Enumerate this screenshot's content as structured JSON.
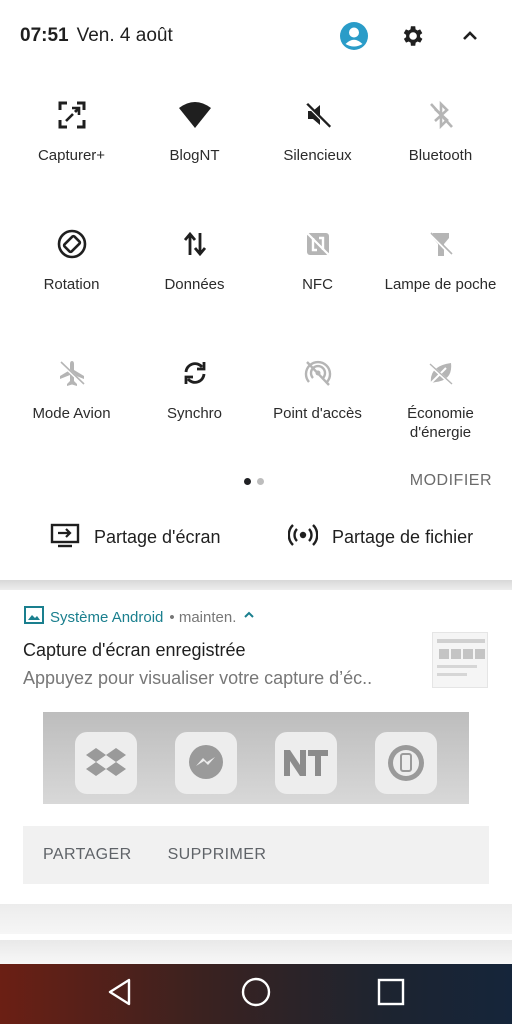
{
  "status_bar": {
    "time": "07:51",
    "date": "Ven. 4 août"
  },
  "tiles": [
    {
      "label": "Capturer+",
      "icon": "screenshot-icon",
      "active": true
    },
    {
      "label": "BlogNT",
      "icon": "wifi-icon",
      "active": true
    },
    {
      "label": "Silencieux",
      "icon": "mute-icon",
      "active": true
    },
    {
      "label": "Bluetooth",
      "icon": "bluetooth-icon",
      "active": false
    },
    {
      "label": "Rotation",
      "icon": "rotation-icon",
      "active": true
    },
    {
      "label": "Données",
      "icon": "data-icon",
      "active": true
    },
    {
      "label": "NFC",
      "icon": "nfc-icon",
      "active": false
    },
    {
      "label": "Lampe de poche",
      "icon": "flashlight-icon",
      "active": false
    },
    {
      "label": "Mode Avion",
      "icon": "airplane-icon",
      "active": false
    },
    {
      "label": "Synchro",
      "icon": "sync-icon",
      "active": true
    },
    {
      "label": "Point d'accès",
      "icon": "hotspot-icon",
      "active": false
    },
    {
      "label": "Économie d'énergie",
      "icon": "battery-saver-icon",
      "active": false
    }
  ],
  "pager": {
    "pages": 2,
    "current": 1
  },
  "modifier_label": "MODIFIER",
  "shortcuts": {
    "screen_share": "Partage d'écran",
    "file_share": "Partage de fichier"
  },
  "notification": {
    "app_name": "Système Android",
    "time": "• mainten.",
    "title": "Capture d'écran enregistrée",
    "text": "Appuyez pour visualiser votre capture d’éc..",
    "actions": {
      "share": "PARTAGER",
      "delete": "SUPPRIMER"
    },
    "accent_color": "#1a7f8e"
  },
  "colors": {
    "active_icon": "#1f1f1f",
    "inactive_icon": "#b5b5b5"
  }
}
